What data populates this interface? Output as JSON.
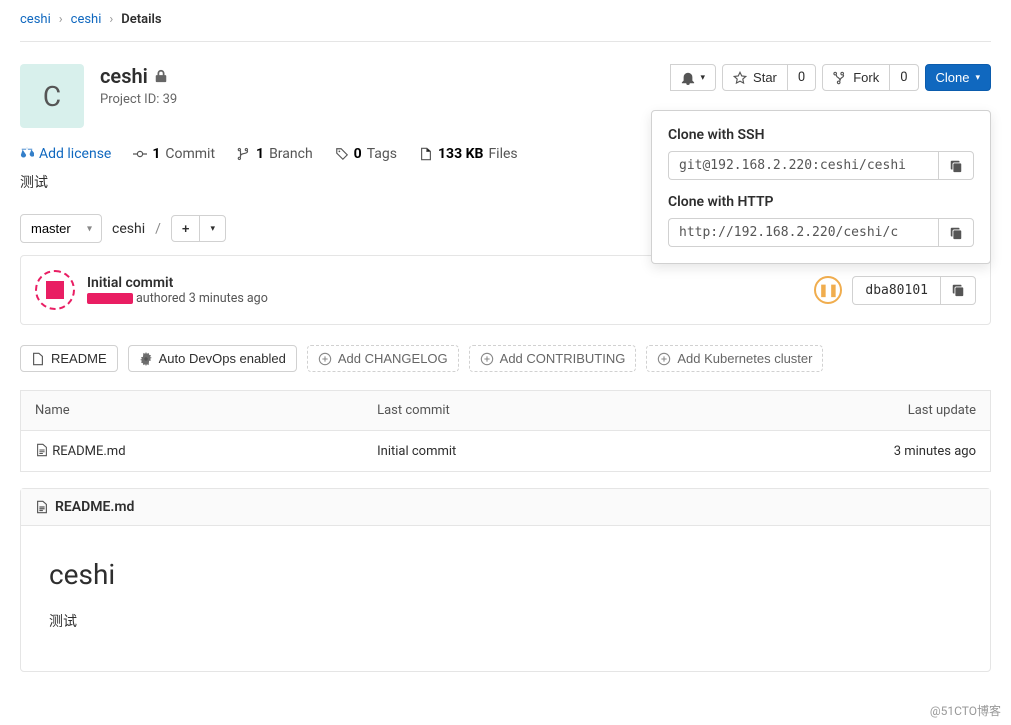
{
  "breadcrumb": {
    "p0": "ceshi",
    "p1": "ceshi",
    "p2": "Details"
  },
  "project": {
    "letter": "C",
    "name": "ceshi",
    "id_label": "Project ID: 39",
    "desc": "测试"
  },
  "header_actions": {
    "star_label": "Star",
    "star_count": "0",
    "fork_label": "Fork",
    "fork_count": "0",
    "clone_label": "Clone"
  },
  "stats": {
    "add_license": "Add license",
    "commits_n": "1",
    "commits_l": "Commit",
    "branches_n": "1",
    "branches_l": "Branch",
    "tags_n": "0",
    "tags_l": "Tags",
    "size": "133 KB",
    "size_l": "Files"
  },
  "branch": {
    "current": "master",
    "path": "ceshi",
    "sep": "/"
  },
  "clone": {
    "ssh_title": "Clone with SSH",
    "ssh_url": "git@192.168.2.220:ceshi/ceshi",
    "http_title": "Clone with HTTP",
    "http_url": "http://192.168.2.220/ceshi/c"
  },
  "commit": {
    "title": "Initial commit",
    "time": "authored 3 minutes ago",
    "sha": "dba80101"
  },
  "actions": {
    "readme": "README",
    "autodevops": "Auto DevOps enabled",
    "changelog": "Add CHANGELOG",
    "contributing": "Add CONTRIBUTING",
    "k8s": "Add Kubernetes cluster"
  },
  "files": {
    "h_name": "Name",
    "h_commit": "Last commit",
    "h_update": "Last update",
    "r0_name": "README.md",
    "r0_commit": "Initial commit",
    "r0_update": "3 minutes ago"
  },
  "readme": {
    "filename": "README.md",
    "h1": "ceshi",
    "body": "测试"
  },
  "watermark": "@51CTO博客"
}
